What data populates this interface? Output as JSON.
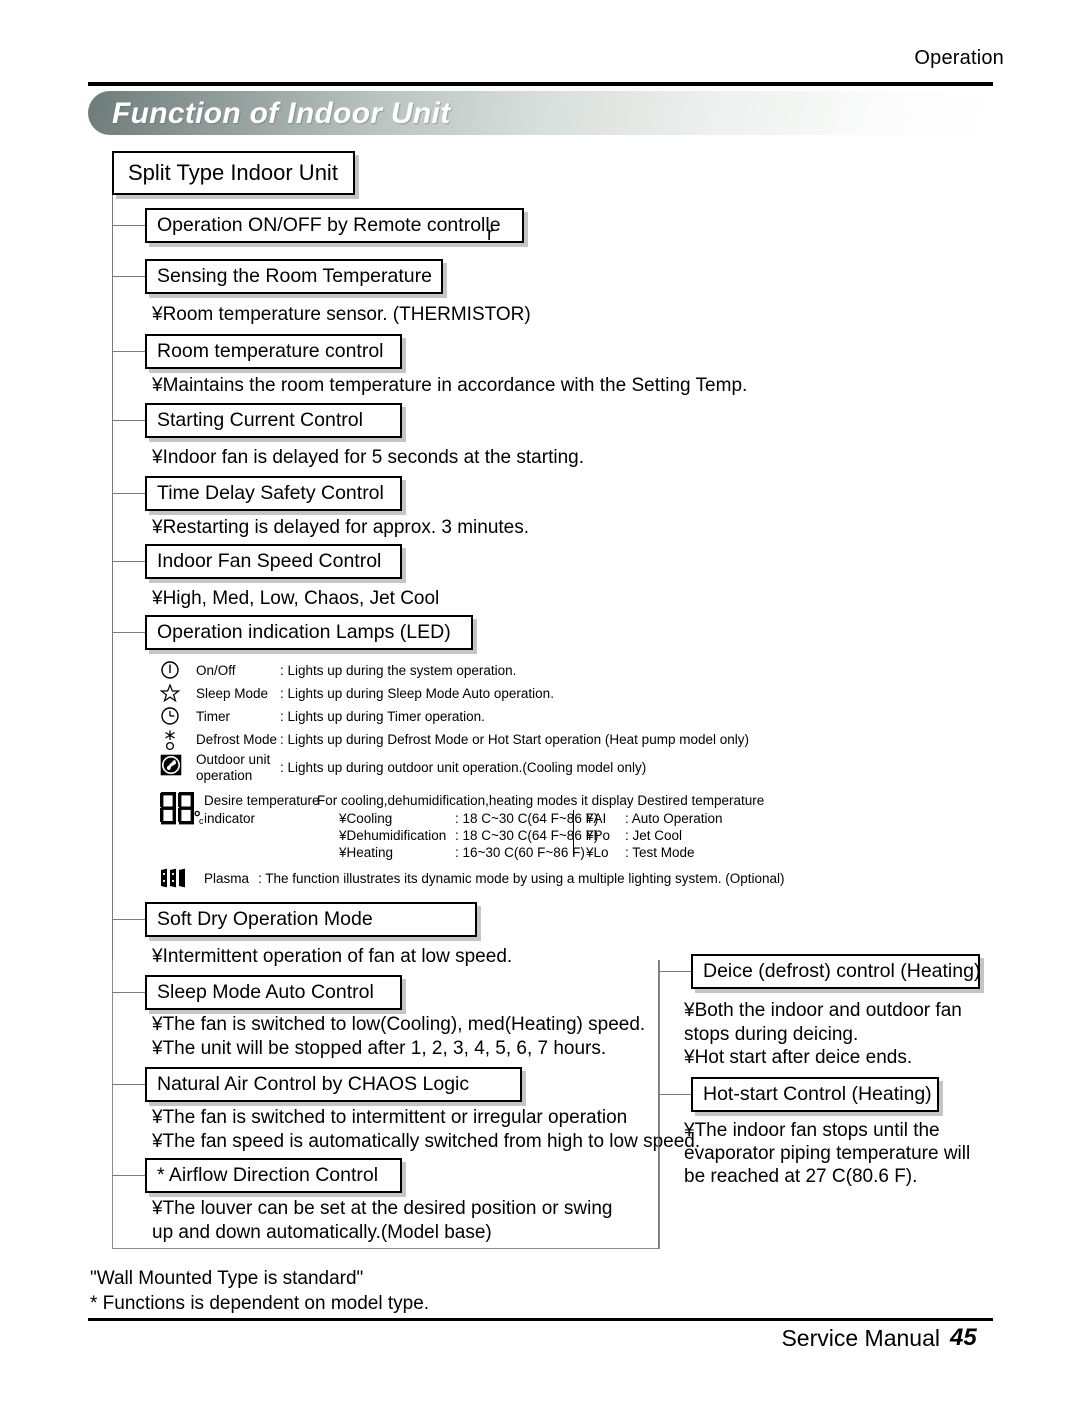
{
  "header": {
    "section": "Operation",
    "banner_title": "Function of Indoor Unit"
  },
  "root_box": "Split Type  Indoor Unit",
  "left_branch": [
    {
      "box": "Operation ON/OFF by Remote controlle",
      "stray": "r",
      "notes": []
    },
    {
      "box": "Sensing the Room Temperature",
      "notes": [
        "¥Room temperature sensor. (THERMISTOR)"
      ]
    },
    {
      "box": "Room temperature control",
      "notes": [
        "¥Maintains the room temperature in accordance with the Setting Temp."
      ]
    },
    {
      "box": "Starting Current Control",
      "notes": [
        "¥Indoor fan is delayed for 5 seconds at the starting."
      ]
    },
    {
      "box": "Time Delay Safety Control",
      "notes": [
        "¥Restarting is delayed for approx. 3 minutes."
      ]
    },
    {
      "box": "Indoor Fan Speed Control",
      "notes": [
        "¥High, Med, Low, Chaos, Jet Cool"
      ]
    },
    {
      "box": "Operation indication Lamps (LED)",
      "notes": []
    },
    {
      "box": "Soft Dry Operation Mode",
      "notes": [
        "¥Intermittent operation of fan at low speed."
      ]
    },
    {
      "box": "Sleep Mode Auto Control",
      "notes": [
        "¥The fan is switched to low(Cooling), med(Heating) speed.",
        "¥The unit will be stopped after 1, 2, 3, 4, 5, 6, 7 hours."
      ]
    },
    {
      "box": " Natural Air Control by CHAOS Logic",
      "notes": [
        "¥The fan is switched to intermittent or irregular operation",
        "¥The fan speed is automatically switched from high to low speed."
      ]
    },
    {
      "box": "* Airflow Direction Control",
      "notes": [
        "¥The louver can be set at the desired position or swing",
        "  up and down automatically.(Model base)"
      ]
    }
  ],
  "right_branch": [
    {
      "box": "Deice (defrost) control (Heating)",
      "notes": [
        "¥Both the indoor and outdoor fan",
        "  stops during deicing.",
        "¥Hot start after deice ends."
      ]
    },
    {
      "box": "Hot-start Control (Heating)",
      "notes": [
        "¥The indoor fan stops until the",
        "  evaporator piping temperature will",
        "  be reached at 27 C(80.6 F)."
      ]
    }
  ],
  "led_legend": [
    {
      "icon": "power-onoff-icon",
      "name": "On/Off",
      "desc": ": Lights up during the system operation."
    },
    {
      "icon": "star-sleep-icon",
      "name": "Sleep Mode",
      "desc": ": Lights up during Sleep Mode Auto operation."
    },
    {
      "icon": "clock-timer-icon",
      "name": "Timer",
      "desc": ": Lights up during Timer operation."
    },
    {
      "icon": "snowflake-defrost-icon",
      "name": "Defrost Mode",
      "desc": ": Lights up during Defrost Mode or Hot Start operation (Heat pump model only)"
    },
    {
      "icon": "fan-outdoor-icon",
      "name": "Outdoor unit",
      "name2": "operation",
      "desc": ": Lights up during outdoor unit operation.(Cooling model only)"
    }
  ],
  "temp_indicator": {
    "icon": "seven-segment-icon",
    "name_line1": "Desire temperature",
    "name_line2": "indicator",
    "heading": "For cooling,dehumidification,heating modes it display Destired temperature",
    "rows_left": [
      {
        "mode": "¥Cooling",
        "range": ": 18 C~30 C(64 F~86 F)"
      },
      {
        "mode": "¥Dehumidification",
        "range": ": 18 C~30 C(64 F~86 F)"
      },
      {
        "mode": "¥Heating",
        "range": ": 16~30 C(60 F~86 F)"
      }
    ],
    "rows_right": [
      {
        "code": "¥AI",
        "meaning": ": Auto Operation"
      },
      {
        "code": "¥Po",
        "meaning": ": Jet Cool"
      },
      {
        "code": "¥Lo",
        "meaning": ": Test Mode"
      }
    ]
  },
  "plasma": {
    "icon": "plasma-icon",
    "name": "Plasma",
    "desc": ": The function illustrates its dynamic mode by using a multiple lighting system. (Optional)"
  },
  "footer": {
    "note1": "\"Wall Mounted Type is standard\"",
    "note2": "* Functions is dependent on model type.",
    "manual_label": "Service Manual",
    "page_number": "45"
  },
  "colors": {
    "banner_start": "#6e7c79",
    "banner_end": "#ffffff",
    "rule": "#000000",
    "box_border": "#000000",
    "line": "#7a7a7a"
  }
}
